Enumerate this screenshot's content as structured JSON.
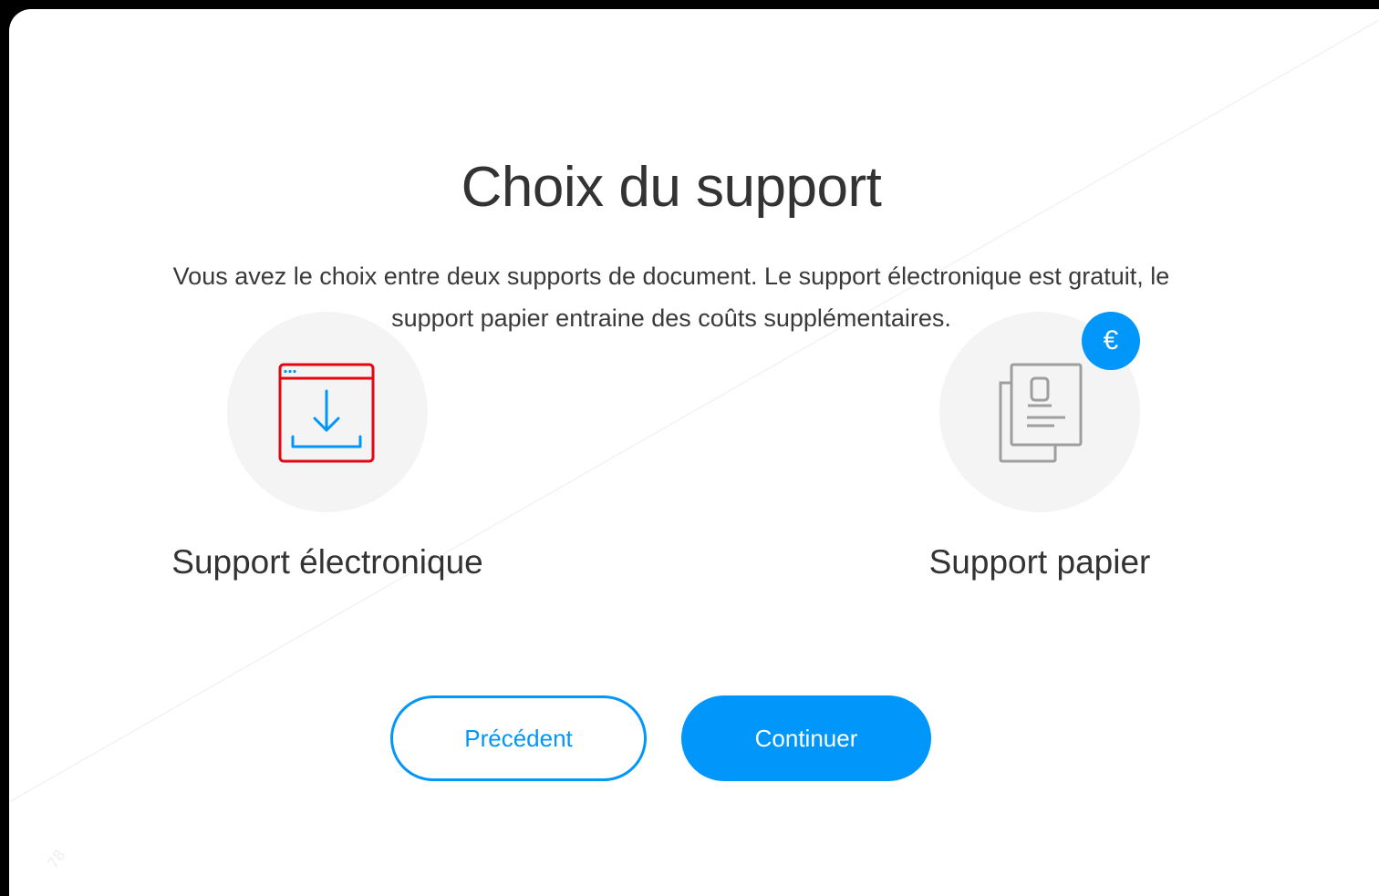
{
  "page": {
    "title": "Choix du support",
    "description": "Vous avez le choix entre deux supports de document. Le support électronique est gratuit, le support papier entraine des coûts supplémentaires."
  },
  "options": [
    {
      "label": "Support électronique",
      "icon": "download-window-icon",
      "selected": true,
      "icon_colors": {
        "frame": "#e30613",
        "arrow": "#0096fa"
      }
    },
    {
      "label": "Support papier",
      "icon": "paper-document-icon",
      "selected": false,
      "badge": "€",
      "icon_colors": {
        "stroke": "#9e9e9e"
      }
    }
  ],
  "buttons": {
    "previous_label": "Précédent",
    "continue_label": "Continuer"
  },
  "colors": {
    "accent": "#0096fa",
    "selected_icon": "#e30613",
    "title_text": "#333333",
    "circle_bg": "#f4f4f4"
  },
  "watermark": "78"
}
